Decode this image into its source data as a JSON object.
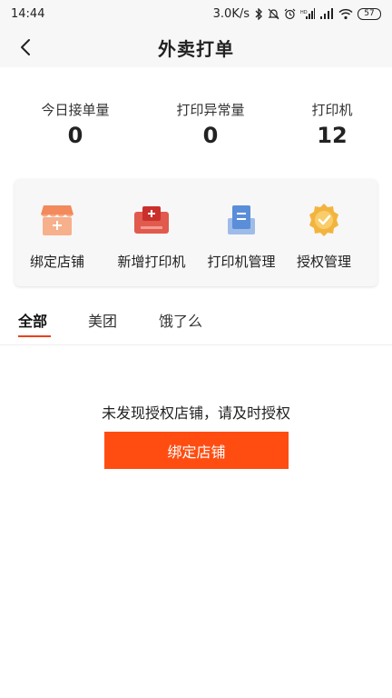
{
  "status_bar": {
    "time": "14:44",
    "network_speed": "3.0K/s",
    "battery": "57"
  },
  "header": {
    "title": "外卖打单"
  },
  "stats": [
    {
      "label": "今日接单量",
      "value": "0"
    },
    {
      "label": "打印异常量",
      "value": "0"
    },
    {
      "label": "打印机",
      "value": "12"
    }
  ],
  "actions": [
    {
      "label": "绑定店铺",
      "icon": "store-icon"
    },
    {
      "label": "新增打印机",
      "icon": "add-printer-icon"
    },
    {
      "label": "打印机管理",
      "icon": "printer-manage-icon"
    },
    {
      "label": "授权管理",
      "icon": "badge-check-icon"
    }
  ],
  "tabs": [
    {
      "label": "全部",
      "active": true
    },
    {
      "label": "美团",
      "active": false
    },
    {
      "label": "饿了么",
      "active": false
    }
  ],
  "empty_state": {
    "message": "未发现授权店铺，请及时授权",
    "button_label": "绑定店铺"
  },
  "colors": {
    "accent": "#ff4d12",
    "tab_underline": "#e8421a",
    "store_icon": "#f28a5b",
    "printer_icon": "#e05a4d",
    "manage_icon": "#5b8ed9",
    "badge_icon": "#f3b43e"
  }
}
